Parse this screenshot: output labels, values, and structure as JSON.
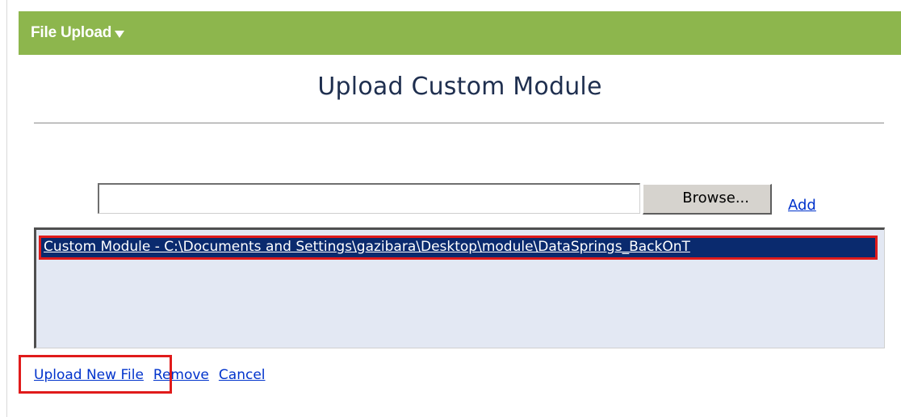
{
  "header": {
    "title": "File Upload",
    "caret_icon": "caret-down-icon",
    "background_color": "#8db64d"
  },
  "main": {
    "page_title": "Upload Custom Module"
  },
  "upload_form": {
    "file_input_value": "",
    "browse_label": "Browse...",
    "add_label": "Add"
  },
  "file_list": {
    "items": [
      {
        "label": "Custom Module - C:\\Documents and Settings\\gazibara\\Desktop\\module\\DataSprings_BackOnT",
        "selected": true
      }
    ]
  },
  "actions": {
    "upload_label": "Upload New File",
    "remove_label": "Remove",
    "cancel_label": "Cancel"
  },
  "colors": {
    "link": "#0033cc",
    "selection": "#0a2a6e",
    "highlight_border": "#e01b1b",
    "list_background": "#e3e8f3"
  }
}
